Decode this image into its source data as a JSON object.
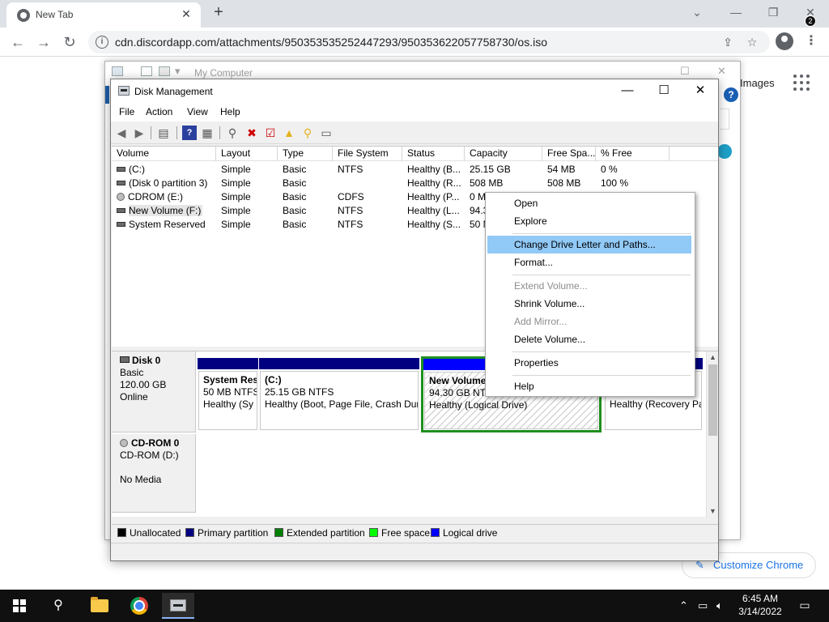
{
  "browser": {
    "tab_title": "New Tab",
    "tab_close": "✕",
    "new_tab": "+",
    "url": "cdn.discordapp.com/attachments/950353535252447293/950353622057758730/os.iso",
    "images_link": "Images",
    "customize_label": "Customize Chrome"
  },
  "bg_window": {
    "title": "My Computer"
  },
  "disk_mgmt": {
    "title": "Disk Management",
    "menu": [
      "File",
      "Action",
      "View",
      "Help"
    ],
    "columns": [
      "Volume",
      "Layout",
      "Type",
      "File System",
      "Status",
      "Capacity",
      "Free Spa...",
      "% Free"
    ],
    "volumes": [
      {
        "volume": "(C:)",
        "layout": "Simple",
        "type": "Basic",
        "fs": "NTFS",
        "status": "Healthy (B...",
        "capacity": "25.15 GB",
        "free": "54 MB",
        "pct": "0 %"
      },
      {
        "volume": "(Disk 0 partition 3)",
        "layout": "Simple",
        "type": "Basic",
        "fs": "",
        "status": "Healthy (R...",
        "capacity": "508 MB",
        "free": "508 MB",
        "pct": "100 %"
      },
      {
        "volume": "CDROM (E:)",
        "layout": "Simple",
        "type": "Basic",
        "fs": "CDFS",
        "status": "Healthy (P...",
        "capacity": "0 M",
        "free": "",
        "pct": ""
      },
      {
        "volume": "New Volume (F:)",
        "layout": "Simple",
        "type": "Basic",
        "fs": "NTFS",
        "status": "Healthy (L...",
        "capacity": "94.3",
        "free": "",
        "pct": ""
      },
      {
        "volume": "System Reserved",
        "layout": "Simple",
        "type": "Basic",
        "fs": "NTFS",
        "status": "Healthy (S...",
        "capacity": "50 M",
        "free": "",
        "pct": ""
      }
    ],
    "disk0": {
      "name": "Disk 0",
      "type": "Basic",
      "size": "120.00 GB",
      "state": "Online",
      "partitions": [
        {
          "name": "System Res",
          "size": "50 MB NTFS",
          "status": "Healthy (Sy"
        },
        {
          "name": "(C:)",
          "size": "25.15 GB NTFS",
          "status": "Healthy (Boot, Page File, Crash Dur"
        },
        {
          "name": "New Volume",
          "size": "94.30 GB NTF",
          "status": "Healthy (Logical Drive)"
        },
        {
          "name": "",
          "size": "",
          "status": "Healthy (Recovery Pa"
        }
      ]
    },
    "cdrom0": {
      "name": "CD-ROM 0",
      "drive": "CD-ROM (D:)",
      "media": "No Media"
    },
    "legend": [
      {
        "label": "Unallocated",
        "color": "#000000"
      },
      {
        "label": "Primary partition",
        "color": "#000080"
      },
      {
        "label": "Extended partition",
        "color": "#008000"
      },
      {
        "label": "Free space",
        "color": "#00ff00"
      },
      {
        "label": "Logical drive",
        "color": "#0000ff"
      }
    ]
  },
  "context_menu": {
    "items": [
      {
        "label": "Open",
        "disabled": false
      },
      {
        "label": "Explore",
        "disabled": false
      },
      {
        "label": "Change Drive Letter and Paths...",
        "disabled": false,
        "active": true
      },
      {
        "label": "Format...",
        "disabled": false
      },
      {
        "label": "Extend Volume...",
        "disabled": true
      },
      {
        "label": "Shrink Volume...",
        "disabled": false
      },
      {
        "label": "Add Mirror...",
        "disabled": true
      },
      {
        "label": "Delete Volume...",
        "disabled": false
      },
      {
        "label": "Properties",
        "disabled": false
      },
      {
        "label": "Help",
        "disabled": false
      }
    ]
  },
  "taskbar": {
    "time": "6:45 AM",
    "date": "3/14/2022",
    "notification_count": "2"
  },
  "colors": {
    "primary_partition": "#000080",
    "logical_drive": "#0000ff",
    "extended_partition": "#008000",
    "menu_highlight": "#91c9f7"
  }
}
